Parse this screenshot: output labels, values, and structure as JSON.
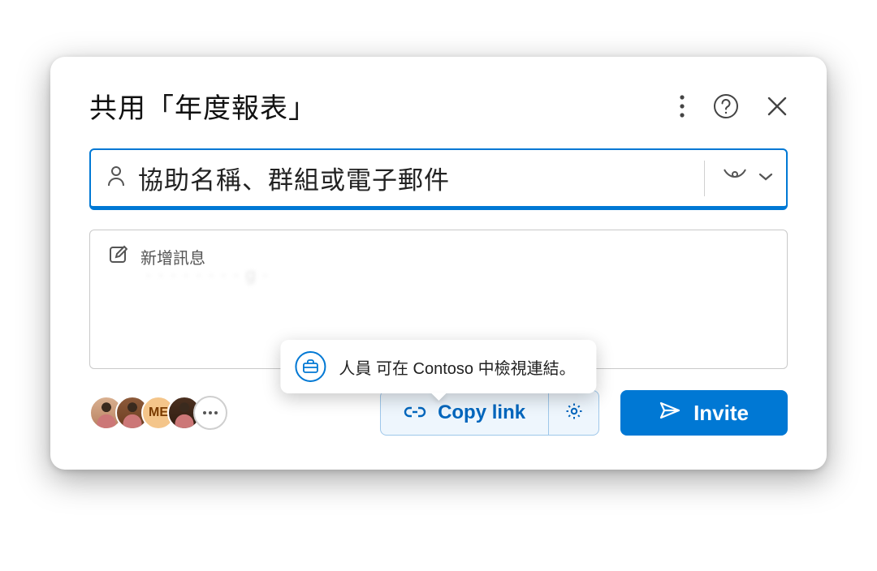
{
  "dialog": {
    "title": "共用「年度報表」"
  },
  "recipient": {
    "placeholder": "協助名稱、群組或電子郵件"
  },
  "message": {
    "placeholder": "新增訊息",
    "blur": "· · · · · · · · g ·"
  },
  "tooltip": {
    "text": "人員 可在 Contoso 中檢視連結。"
  },
  "avatars": {
    "initials3": "ME"
  },
  "footer": {
    "copy_label": "Copy link",
    "invite_label": "Invite"
  }
}
